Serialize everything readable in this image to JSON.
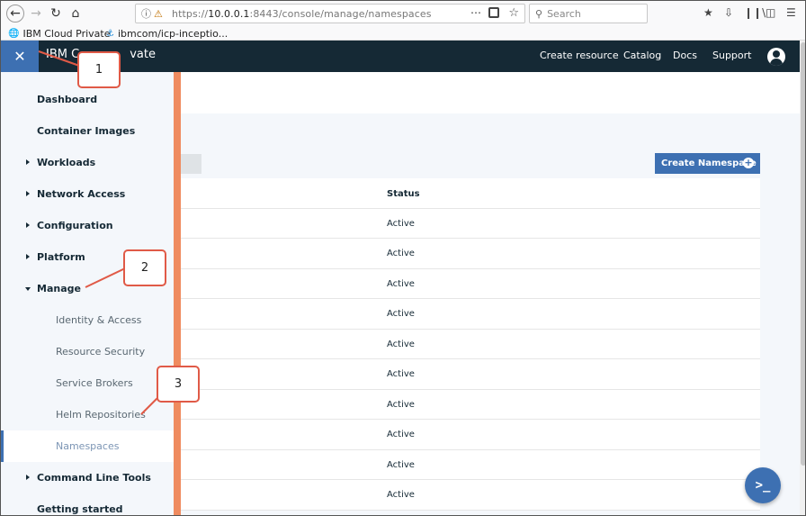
{
  "browser": {
    "url_prefix": "https://",
    "url_host": "10.0.0.1",
    "url_rest": ":8443/console/manage/namespaces",
    "search_placeholder": "Search",
    "more_icon": "⋯",
    "bookmarks": [
      {
        "label": "IBM Cloud Private",
        "icon": "globe-icon"
      },
      {
        "label": "ibmcom/icp-inceptio...",
        "icon": "docker-icon"
      }
    ]
  },
  "header": {
    "brand_visible": "IBM C",
    "brand_tail": "vate",
    "links": [
      "Create resource",
      "Catalog",
      "Docs",
      "Support"
    ]
  },
  "sidebar": {
    "items": [
      {
        "label": "Dashboard",
        "type": "top"
      },
      {
        "label": "Container Images",
        "type": "top"
      },
      {
        "label": "Workloads",
        "type": "top",
        "expandable": true
      },
      {
        "label": "Network Access",
        "type": "top",
        "expandable": true
      },
      {
        "label": "Configuration",
        "type": "top",
        "expandable": true
      },
      {
        "label": "Platform",
        "type": "top",
        "expandable": true
      },
      {
        "label": "Manage",
        "type": "top",
        "expanded": true
      },
      {
        "label": "Identity & Access",
        "type": "sub"
      },
      {
        "label": "Resource Security",
        "type": "sub"
      },
      {
        "label": "Service Brokers",
        "type": "sub"
      },
      {
        "label": "Helm Repositories",
        "type": "sub"
      },
      {
        "label": "Namespaces",
        "type": "sub",
        "active": true
      },
      {
        "label": "Command Line Tools",
        "type": "top",
        "expandable": true
      },
      {
        "label": "Getting started",
        "type": "top"
      }
    ]
  },
  "main": {
    "create_button": "Create Namespace",
    "table": {
      "status_header": "Status",
      "rows": [
        "Active",
        "Active",
        "Active",
        "Active",
        "Active",
        "Active",
        "Active",
        "Active",
        "Active",
        "Active"
      ]
    }
  },
  "callouts": [
    "1",
    "2",
    "3"
  ],
  "colors": {
    "header_bg": "#152935",
    "accent_blue": "#3d70b2",
    "sidebar_edge": "#ef8b5f",
    "callout_border": "#e05a47"
  }
}
